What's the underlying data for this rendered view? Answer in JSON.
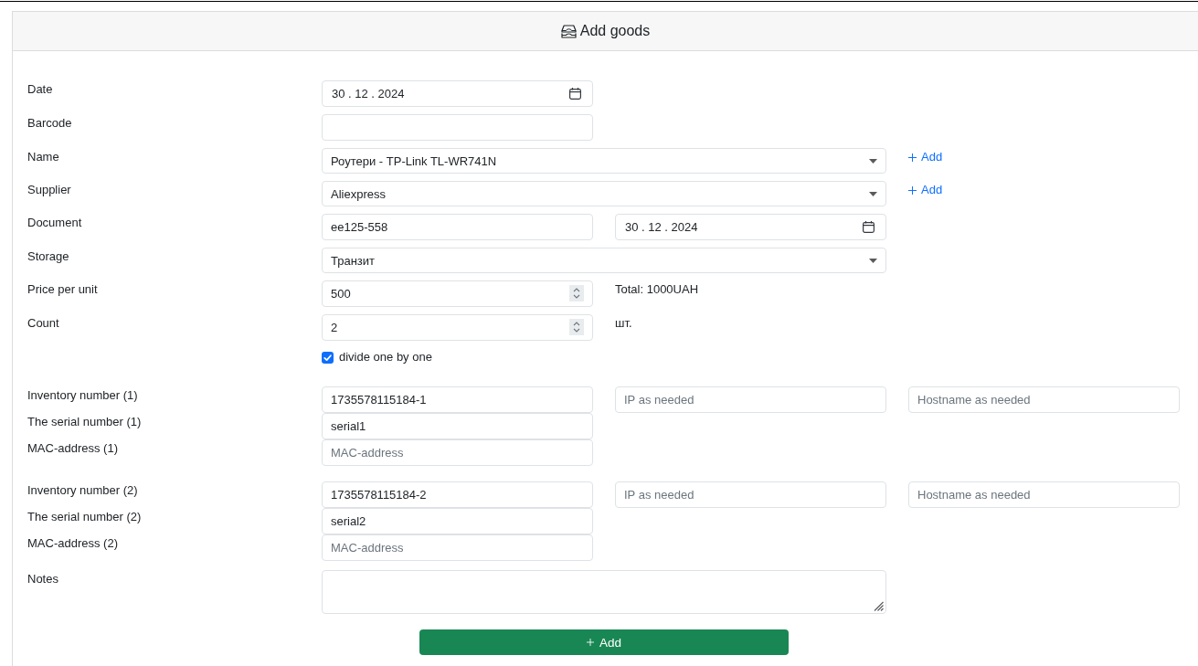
{
  "header": {
    "title": "Add goods"
  },
  "rows": [
    {
      "kind": "date",
      "label": "Date",
      "value": "30 . 12 . 2024"
    },
    {
      "kind": "text",
      "label": "Barcode"
    },
    {
      "kind": "select",
      "label": "Name",
      "value": "Роутери - TP-Link TL-WR741N",
      "action": "Add"
    },
    {
      "kind": "select",
      "label": "Supplier",
      "value": "Aliexpress",
      "action": "Add"
    },
    {
      "kind": "text",
      "label": "Document",
      "value": "ee125-558",
      "extra": {
        "kind": "date",
        "value": "30 . 12 . 2024"
      }
    },
    {
      "kind": "select",
      "label": "Storage",
      "value": "Транзит"
    },
    {
      "kind": "number",
      "label": "Price per unit",
      "value": "500",
      "note": "Total: 1000UAH"
    },
    {
      "kind": "number",
      "label": "Count",
      "value": "2",
      "note": "шт."
    },
    {
      "kind": "checkbox",
      "text": "divide one by one",
      "checked": true
    }
  ],
  "units": [
    {
      "rows": [
        {
          "label": "Inventory number (1)",
          "value": "1735578115184-1",
          "extras": [
            {
              "placeholder": "IP as needed"
            },
            {
              "placeholder": "Hostname as needed"
            }
          ]
        },
        {
          "label": "The serial number (1)",
          "value": "serial1"
        },
        {
          "label": "MAC-address (1)",
          "placeholder": "MAC-address"
        }
      ]
    },
    {
      "rows": [
        {
          "label": "Inventory number (2)",
          "value": "1735578115184-2",
          "extras": [
            {
              "placeholder": "IP as needed"
            },
            {
              "placeholder": "Hostname as needed"
            }
          ]
        },
        {
          "label": "The serial number (2)",
          "value": "serial2"
        },
        {
          "label": "MAC-address (2)",
          "placeholder": "MAC-address"
        }
      ]
    }
  ],
  "notes": {
    "label": "Notes"
  },
  "submit": {
    "label": "Add"
  }
}
